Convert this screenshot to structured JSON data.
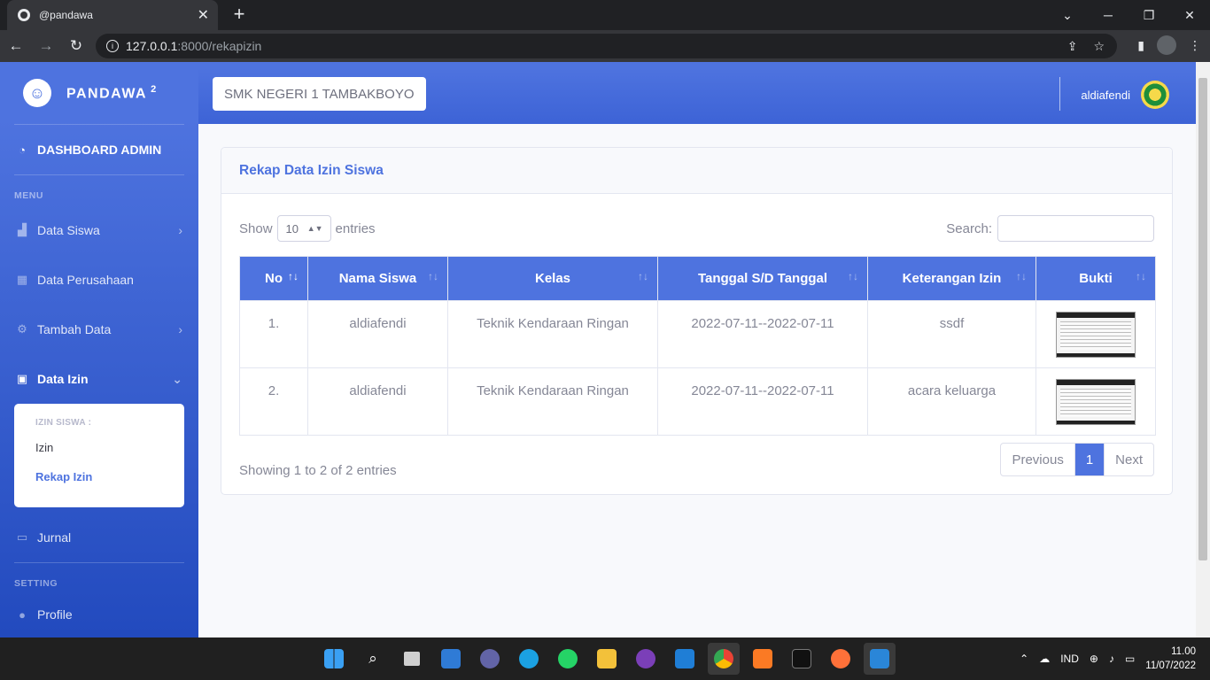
{
  "browser": {
    "tab_title": "@pandawa",
    "url_host": "127.0.0.1",
    "url_path": ":8000/rekapizin"
  },
  "sidebar": {
    "brand": "PANDAWA",
    "brand_sup": "2",
    "dashboard": "DASHBOARD ADMIN",
    "menu_heading": "MENU",
    "items": [
      {
        "label": "Data Siswa"
      },
      {
        "label": "Data Perusahaan"
      },
      {
        "label": "Tambah Data"
      },
      {
        "label": "Data Izin"
      }
    ],
    "submenu": {
      "heading": "IZIN SISWA :",
      "items": [
        {
          "label": "Izin"
        },
        {
          "label": "Rekap Izin"
        }
      ]
    },
    "jurnal": "Jurnal",
    "setting_heading": "SETTING",
    "profile": "Profile"
  },
  "topbar": {
    "school": "SMK NEGERI 1 TAMBAKBOYO",
    "username": "aldiafendi"
  },
  "card": {
    "title": "Rekap Data Izin Siswa",
    "show_label": "Show",
    "entries_value": "10",
    "entries_label": "entries",
    "search_label": "Search:",
    "columns": [
      "No",
      "Nama Siswa",
      "Kelas",
      "Tanggal S/D Tanggal",
      "Keterangan Izin",
      "Bukti"
    ],
    "rows": [
      {
        "no": "1.",
        "nama": "aldiafendi",
        "kelas": "Teknik Kendaraan Ringan",
        "tanggal": "2022-07-11--2022-07-11",
        "ket": "ssdf"
      },
      {
        "no": "2.",
        "nama": "aldiafendi",
        "kelas": "Teknik Kendaraan Ringan",
        "tanggal": "2022-07-11--2022-07-11",
        "ket": "acara keluarga"
      }
    ],
    "info": "Showing 1 to 2 of 2 entries",
    "pager": {
      "prev": "Previous",
      "page": "1",
      "next": "Next"
    }
  },
  "taskbar": {
    "lang": "IND",
    "time": "11.00",
    "date": "11/07/2022"
  },
  "colors": {
    "primary": "#4e73df",
    "text_muted": "#858796"
  }
}
